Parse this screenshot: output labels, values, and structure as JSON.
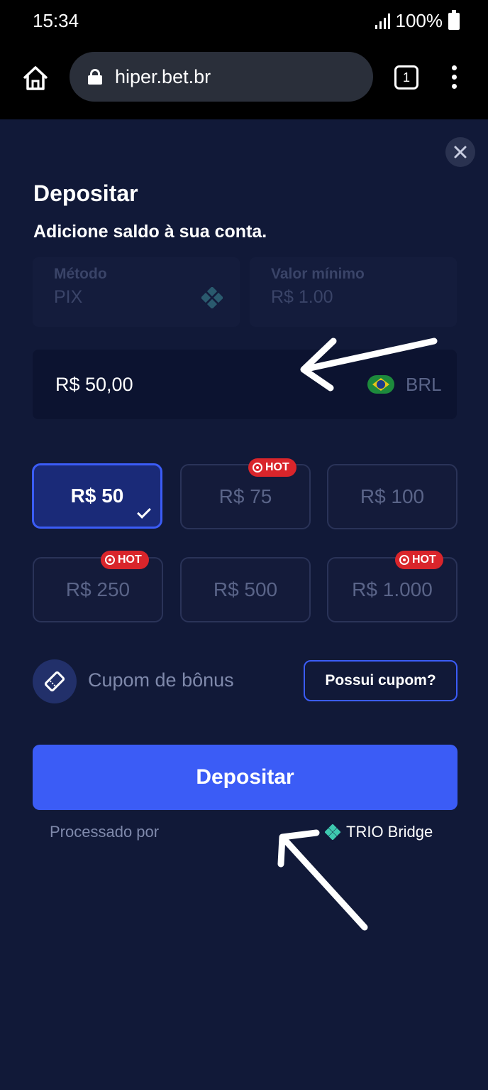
{
  "status_bar": {
    "time": "15:34",
    "battery": "100%"
  },
  "browser": {
    "url": "hiper.bet.br",
    "tab_count": "1"
  },
  "modal": {
    "title": "Depositar",
    "subtitle": "Adicione saldo à sua conta.",
    "method": {
      "label": "Método",
      "value": "PIX"
    },
    "min_value": {
      "label": "Valor mínimo",
      "value": "R$ 1.00"
    },
    "amount": {
      "value": "R$ 50,00",
      "currency": "BRL"
    },
    "chips": [
      {
        "label": "R$ 50",
        "selected": true,
        "hot": false
      },
      {
        "label": "R$ 75",
        "selected": false,
        "hot": true
      },
      {
        "label": "R$ 100",
        "selected": false,
        "hot": false
      },
      {
        "label": "R$ 250",
        "selected": false,
        "hot": true
      },
      {
        "label": "R$ 500",
        "selected": false,
        "hot": false
      },
      {
        "label": "R$ 1.000",
        "selected": false,
        "hot": true
      }
    ],
    "hot_label": "HOT",
    "coupon": {
      "label": "Cupom de bônus",
      "button": "Possui cupom?"
    },
    "deposit_button": "Depositar",
    "processed_by": "Processado por",
    "processor": "TRIO Bridge"
  },
  "colors": {
    "background": "#111938",
    "accent": "#3b5cf6",
    "hot": "#d9252b"
  }
}
